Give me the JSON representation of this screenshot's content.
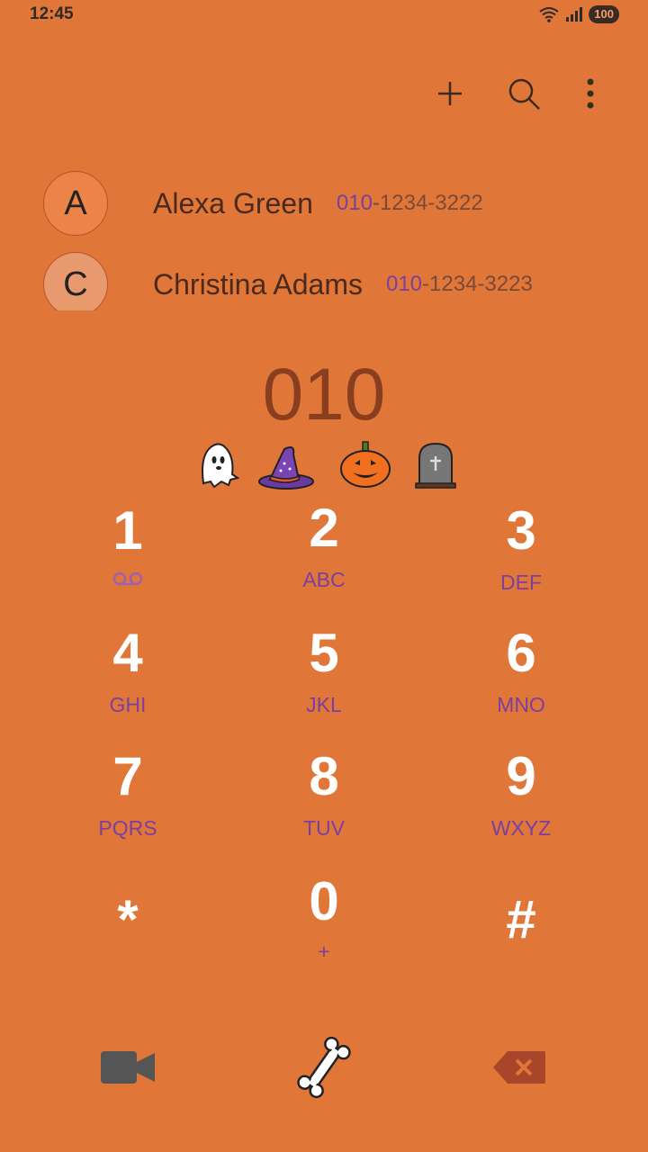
{
  "status": {
    "time": "12:45",
    "battery": "100"
  },
  "toolbar": {
    "add_icon": "plus-icon",
    "search_icon": "search-icon",
    "menu_icon": "more-vert-icon"
  },
  "contacts": [
    {
      "initial": "A",
      "name": "Alexa Green",
      "number_highlight": "010",
      "number_rest": "-1234-3222",
      "avatar_color": "#ec8447"
    },
    {
      "initial": "C",
      "name": "Christina Adams",
      "number_highlight": "010",
      "number_rest": "-1234-3223",
      "avatar_color": "#e89a6e"
    }
  ],
  "dialed_number": "010",
  "decorations": [
    "ghost-icon",
    "witch-hat-icon",
    "pumpkin-icon",
    "tombstone-icon"
  ],
  "keypad": [
    {
      "digit": "1",
      "letters": "",
      "sub_icon": "voicemail-icon"
    },
    {
      "digit": "2",
      "letters": "ABC"
    },
    {
      "digit": "3",
      "letters": "DEF"
    },
    {
      "digit": "4",
      "letters": "GHI"
    },
    {
      "digit": "5",
      "letters": "JKL"
    },
    {
      "digit": "6",
      "letters": "MNO"
    },
    {
      "digit": "7",
      "letters": "PQRS"
    },
    {
      "digit": "8",
      "letters": "TUV"
    },
    {
      "digit": "9",
      "letters": "WXYZ"
    },
    {
      "digit": "*",
      "letters": ""
    },
    {
      "digit": "0",
      "letters": "+"
    },
    {
      "digit": "#",
      "letters": ""
    }
  ],
  "bottom": {
    "video_icon": "video-call-icon",
    "call_icon": "bone-call-icon",
    "delete_icon": "backspace-icon"
  },
  "colors": {
    "background": "#e07638",
    "accent": "#7b3fa0",
    "digit": "#ffffff",
    "dialed": "#8a3e20"
  }
}
